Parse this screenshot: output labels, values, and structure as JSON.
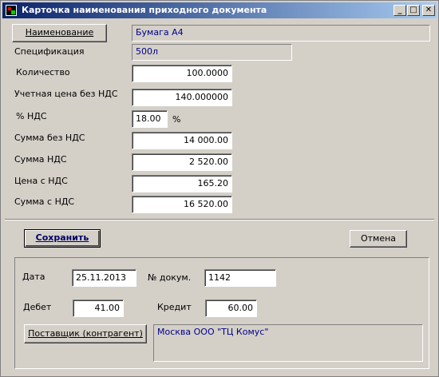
{
  "window": {
    "title": "Карточка наименования приходного документа",
    "controls": {
      "minimize": "_",
      "maximize": "□",
      "close": "✕"
    }
  },
  "form": {
    "name_button": "Наименование",
    "name_value": "Бумага А4",
    "spec_label": "Спецификация",
    "spec_value": "500л",
    "qty_label": "Количество",
    "qty_value": "100.0000",
    "price_label": "Учетная цена без НДС",
    "price_value": "140.000000",
    "vat_pct_label": "% НДС",
    "vat_pct_value": "18.00",
    "vat_pct_unit": "%",
    "sum_novat_label": "Сумма без НДС",
    "sum_novat_value": "14 000.00",
    "vat_sum_label": "Сумма НДС",
    "vat_sum_value": "2 520.00",
    "price_vat_label": "Цена с НДС",
    "price_vat_value": "165.20",
    "sum_vat_label": "Сумма с НДС",
    "sum_vat_value": "16 520.00"
  },
  "actions": {
    "save": "Сохранить",
    "cancel": "Отмена"
  },
  "document": {
    "date_label": "Дата",
    "date_value": "25.11.2013",
    "doc_no_label": "№ докум.",
    "doc_no_value": "1142",
    "debit_label": "Дебет",
    "debit_value": "41.00",
    "credit_label": "Кредит",
    "credit_value": "60.00",
    "supplier_button": "Поставщик (контрагент)",
    "supplier_value": "Москва ООО \"ТЦ Комус\""
  }
}
